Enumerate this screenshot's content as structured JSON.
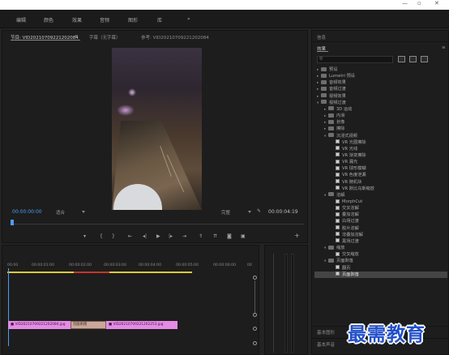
{
  "menu": [
    "编辑",
    "颜色",
    "效果",
    "音频",
    "图形",
    "库"
  ],
  "menu_overflow": "»",
  "monitor": {
    "tabs": [
      "节目: VID20210709221202084",
      "字幕（无字幕）",
      "参考: VID20210709221202084"
    ],
    "tab_menu": "≡",
    "timecode_current": "00:00:00:00",
    "fit": "适合",
    "quality": "完整",
    "timecode_duration": "00:00:04:19",
    "wrench_icon": "wrench-icon",
    "controls": [
      "marker-icon",
      "in-point-icon",
      "out-point-icon",
      "go-to-in-icon",
      "step-back-icon",
      "play-icon",
      "step-forward-icon",
      "go-to-out-icon",
      "lift-icon",
      "extract-icon",
      "export-frame-icon",
      "compare-icon"
    ],
    "add_button": "+"
  },
  "timeline": {
    "ruler": [
      "00:00",
      "00:00:01:00",
      "00:00:02:00",
      "00:00:03:00",
      "00:00:04:00",
      "00:00:05:00",
      "00:00:06:00",
      "00"
    ],
    "clip_a": "VID20210709221202084.jpg",
    "transition": "页面剥落",
    "clip_b": "VID20210709221202253.jpg"
  },
  "effects_panel": {
    "top_tab": "信息",
    "title": "效果",
    "menu": "≡",
    "search_placeholder": "",
    "tree": [
      {
        "label": "预设",
        "type": "folder",
        "level": 0,
        "open": false
      },
      {
        "label": "Lumetri 预设",
        "type": "folder",
        "level": 0,
        "open": false
      },
      {
        "label": "音频效果",
        "type": "folder",
        "level": 0,
        "open": false
      },
      {
        "label": "音频过渡",
        "type": "folder",
        "level": 0,
        "open": false
      },
      {
        "label": "视频效果",
        "type": "folder",
        "level": 0,
        "open": false
      },
      {
        "label": "视频过渡",
        "type": "folder",
        "level": 0,
        "open": true
      },
      {
        "label": "3D 运动",
        "type": "folder",
        "level": 1,
        "open": false
      },
      {
        "label": "内滑",
        "type": "folder",
        "level": 1,
        "open": false
      },
      {
        "label": "划像",
        "type": "folder",
        "level": 1,
        "open": false
      },
      {
        "label": "擦除",
        "type": "folder",
        "level": 1,
        "open": false
      },
      {
        "label": "沉浸式视频",
        "type": "folder",
        "level": 1,
        "open": true
      },
      {
        "label": "VR 光圈擦除",
        "type": "fx",
        "level": 2
      },
      {
        "label": "VR 光线",
        "type": "fx",
        "level": 2
      },
      {
        "label": "VR 渐变擦除",
        "type": "fx",
        "level": 2
      },
      {
        "label": "VR 漏光",
        "type": "fx",
        "level": 2
      },
      {
        "label": "VR 球形模糊",
        "type": "fx",
        "level": 2
      },
      {
        "label": "VR 色度泄漏",
        "type": "fx",
        "level": 2
      },
      {
        "label": "VR 随机块",
        "type": "fx",
        "level": 2
      },
      {
        "label": "VR 默比乌斯缩放",
        "type": "fx",
        "level": 2
      },
      {
        "label": "溶解",
        "type": "folder",
        "level": 1,
        "open": true
      },
      {
        "label": "MorphCut",
        "type": "fx",
        "level": 2
      },
      {
        "label": "交叉溶解",
        "type": "fx",
        "level": 2
      },
      {
        "label": "叠加溶解",
        "type": "fx",
        "level": 2
      },
      {
        "label": "白场过渡",
        "type": "fx",
        "level": 2
      },
      {
        "label": "胶片溶解",
        "type": "fx",
        "level": 2
      },
      {
        "label": "非叠加溶解",
        "type": "fx",
        "level": 2
      },
      {
        "label": "黑场过渡",
        "type": "fx",
        "level": 2
      },
      {
        "label": "缩放",
        "type": "folder",
        "level": 1,
        "open": true
      },
      {
        "label": "交叉缩放",
        "type": "fx",
        "level": 2
      },
      {
        "label": "页面剥落",
        "type": "folder",
        "level": 1,
        "open": true
      },
      {
        "label": "翻页",
        "type": "fx",
        "level": 2
      },
      {
        "label": "页面剥落",
        "type": "fx",
        "level": 2,
        "selected": true
      }
    ],
    "bottom_items": [
      "基本图形",
      "基本声音"
    ]
  },
  "watermark": "最需教育",
  "colors": {
    "accent_blue": "#4f9cf0",
    "clip_pink": "#e58be5",
    "work_area_yellow": "#e0c838",
    "render_red": "#c8342a",
    "watermark_blue": "#2250c8"
  }
}
